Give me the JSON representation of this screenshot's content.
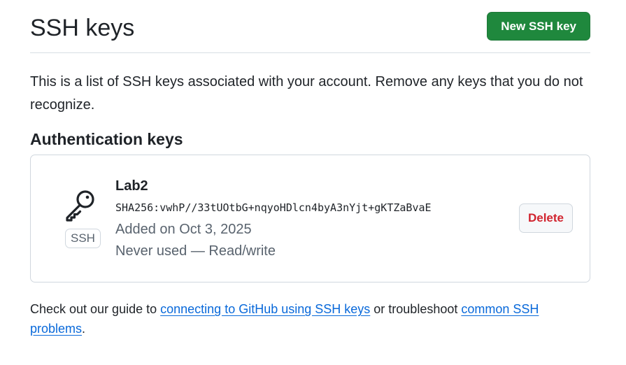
{
  "header": {
    "title": "SSH keys",
    "new_key_button": "New SSH key"
  },
  "intro_text": "This is a list of SSH keys associated with your account. Remove any keys that you do not recognize.",
  "section_title": "Authentication keys",
  "keys": [
    {
      "title": "Lab2",
      "icon": "key-icon",
      "type_badge": "SSH",
      "fingerprint": "SHA256:vwhP//33tUOtbG+nqyoHDlcn4byA3nYjt+gKTZaBvaE",
      "added": "Added on Oct 3, 2025",
      "usage": "Never used — Read/write",
      "delete_label": "Delete"
    }
  ],
  "footer": {
    "prefix": "Check out our guide to ",
    "link1": "connecting to GitHub using SSH keys",
    "middle": " or troubleshoot ",
    "link2": "common SSH problems",
    "suffix": "."
  },
  "colors": {
    "primary_button": "#1f883d",
    "danger_text": "#d1242f",
    "link": "#0969da",
    "muted_text": "#59636e",
    "border": "#d0d7de"
  }
}
